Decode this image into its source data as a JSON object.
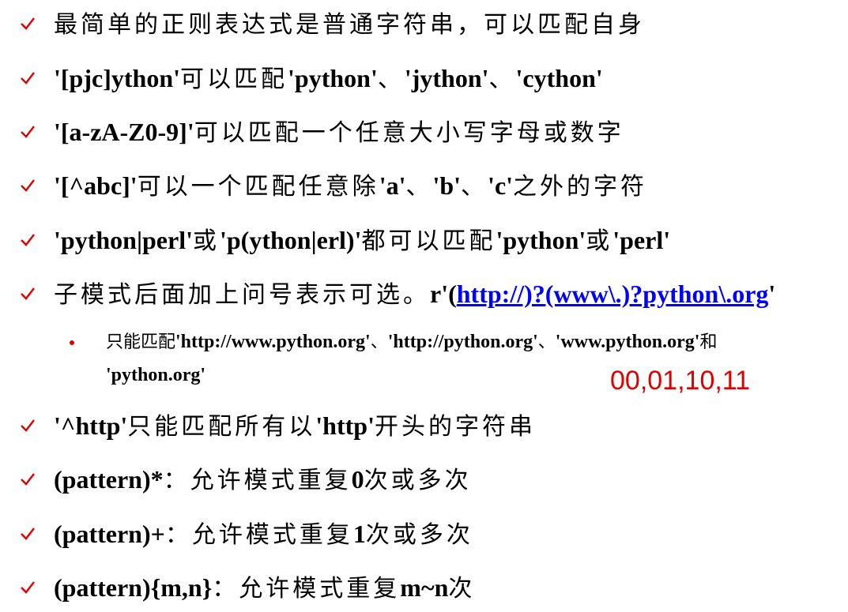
{
  "colors": {
    "checkmark": "#e00000",
    "bullet": "#e00000",
    "link": "#0000ff",
    "annotation": "#e00000",
    "text": "#000000"
  },
  "icons": {
    "checkmark": "checkmark-icon",
    "bullet": "bullet-dot-icon"
  },
  "items": [
    {
      "parts": [
        {
          "t": "cn",
          "v": "最简单的正则表达式是普通字符串，可以匹配自身"
        }
      ]
    },
    {
      "parts": [
        {
          "t": "b",
          "v": "'[pjc]ython'"
        },
        {
          "t": "cn",
          "v": "可以匹配"
        },
        {
          "t": "b",
          "v": "'python'"
        },
        {
          "t": "cn",
          "v": "、"
        },
        {
          "t": "b",
          "v": "'jython'"
        },
        {
          "t": "cn",
          "v": "、"
        },
        {
          "t": "b",
          "v": "'cython'"
        }
      ]
    },
    {
      "parts": [
        {
          "t": "b",
          "v": "'[a-zA-Z0-9]'"
        },
        {
          "t": "cn",
          "v": "可以匹配一个任意大小写字母或数字"
        }
      ]
    },
    {
      "parts": [
        {
          "t": "b",
          "v": "'[^abc]'"
        },
        {
          "t": "cn",
          "v": "可以一个匹配任意除"
        },
        {
          "t": "b",
          "v": "'a'"
        },
        {
          "t": "cn",
          "v": "、"
        },
        {
          "t": "b",
          "v": "'b'"
        },
        {
          "t": "cn",
          "v": "、"
        },
        {
          "t": "b",
          "v": "'c'"
        },
        {
          "t": "cn",
          "v": "之外的字符"
        }
      ]
    },
    {
      "parts": [
        {
          "t": "b",
          "v": "'python|perl'"
        },
        {
          "t": "cn",
          "v": "或"
        },
        {
          "t": "b",
          "v": "'p(ython|erl)'"
        },
        {
          "t": "cn",
          "v": "都可以匹配"
        },
        {
          "t": "b",
          "v": "'python'"
        },
        {
          "t": "cn",
          "v": "或"
        },
        {
          "t": "b",
          "v": "'perl'"
        }
      ]
    },
    {
      "parts": [
        {
          "t": "cn",
          "v": "子模式后面加上问号表示可选。"
        },
        {
          "t": "b",
          "v": "r'("
        },
        {
          "t": "link",
          "v": "http://)?(www\\.)?python\\.org"
        },
        {
          "t": "b",
          "v": "'"
        }
      ]
    },
    {
      "parts": [
        {
          "t": "b",
          "v": "'^http'"
        },
        {
          "t": "cn",
          "v": "只能匹配所有以"
        },
        {
          "t": "b",
          "v": "'http'"
        },
        {
          "t": "cn",
          "v": "开头的字符串"
        }
      ]
    },
    {
      "parts": [
        {
          "t": "b",
          "v": "(pattern)*"
        },
        {
          "t": "cn",
          "v": "：允许模式重复"
        },
        {
          "t": "b",
          "v": "0"
        },
        {
          "t": "cn",
          "v": "次或多次"
        }
      ]
    },
    {
      "parts": [
        {
          "t": "b",
          "v": "(pattern)+"
        },
        {
          "t": "cn",
          "v": "：允许模式重复"
        },
        {
          "t": "b",
          "v": "1"
        },
        {
          "t": "cn",
          "v": "次或多次"
        }
      ]
    },
    {
      "parts": [
        {
          "t": "b",
          "v": "(pattern){m,n}"
        },
        {
          "t": "cn",
          "v": "：允许模式重复"
        },
        {
          "t": "b",
          "v": "m~n"
        },
        {
          "t": "cn",
          "v": "次"
        }
      ]
    }
  ],
  "sub_item": {
    "line1": [
      {
        "t": "cn",
        "v": "只能匹配"
      },
      {
        "t": "b",
        "v": "'http://www.python.org'"
      },
      {
        "t": "cn",
        "v": "、"
      },
      {
        "t": "b",
        "v": "'http://python.org'"
      },
      {
        "t": "cn",
        "v": "、"
      },
      {
        "t": "b",
        "v": "'www.python.org'"
      },
      {
        "t": "cn",
        "v": "和"
      }
    ],
    "line2": [
      {
        "t": "b",
        "v": "'python.org'"
      }
    ]
  },
  "annotation": "00,01,10,11"
}
